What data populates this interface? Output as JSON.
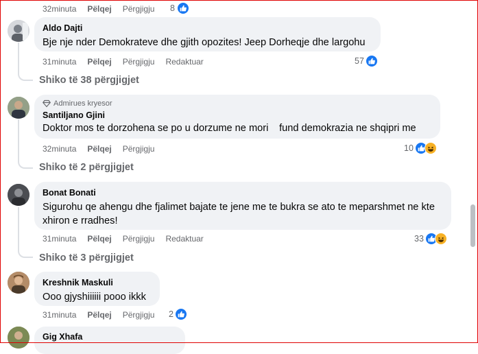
{
  "top_meta": {
    "time": "32minuta",
    "like": "Pëlqej",
    "reply": "Përgjigju",
    "count": "8"
  },
  "comments": [
    {
      "author": "Aldo Dajti",
      "text": "Bje nje nder Demokrateve dhe gjith opozites! Jeep Dorheqje dhe largohu",
      "time": "31minuta",
      "like": "Pëlqej",
      "reply": "Përgjigju",
      "edited": "Redaktuar",
      "count": "57",
      "view_replies": "Shiko të 38 përgjigjet"
    },
    {
      "badge": "Admirues kryesor",
      "author": "Santiljano Gjini",
      "text": "Doktor mos te dorzohena se po u dorzume ne mori fund demokrazia ne shqipri me",
      "time": "32minuta",
      "like": "Pëlqej",
      "reply": "Përgjigju",
      "count": "10",
      "view_replies": "Shiko të 2 përgjigjet"
    },
    {
      "author": "Bonat Bonati",
      "text": "Sigurohu qe ahengu dhe fjalimet bajate te jene me te bukra se ato te meparshmet ne kte xhiron e rradhes!",
      "time": "31minuta",
      "like": "Pëlqej",
      "reply": "Përgjigju",
      "edited": "Redaktuar",
      "count": "33",
      "view_replies": "Shiko të 3 përgjigjet"
    },
    {
      "author": "Kreshnik Maskuli",
      "text": "Ooo gjyshiiiiii pooo ikkk",
      "time": "31minuta",
      "like": "Pëlqej",
      "reply": "Përgjigju",
      "count": "2"
    },
    {
      "author": "Gig Xhafa",
      "text": ""
    }
  ],
  "colors": {
    "like_blue": "#1877f2",
    "bubble": "#f0f2f5",
    "meta_gray": "#65676b"
  }
}
